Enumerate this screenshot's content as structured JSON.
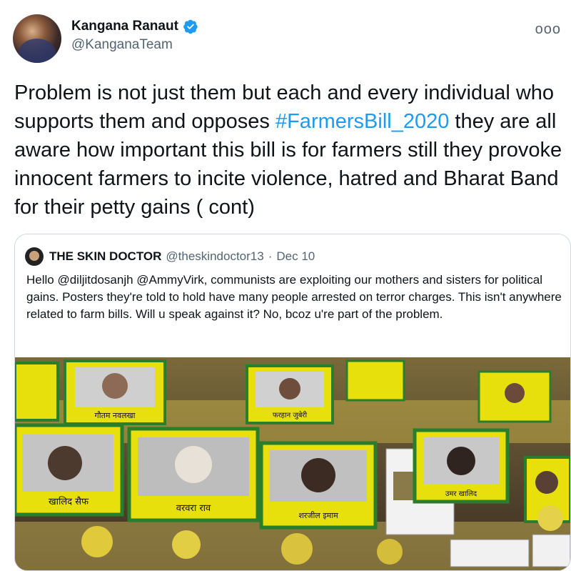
{
  "author": {
    "name": "Kangana Ranaut",
    "handle": "@KanganaTeam",
    "verified_icon": "verified-badge-icon"
  },
  "more_label": "ooo",
  "tweet": {
    "text_before": "Problem is not just them but each and every individual who supports them and opposes ",
    "hashtag": "#FarmersBill_2020",
    "text_after": " they are all aware how important this bill is for farmers still they provoke innocent farmers to incite violence, hatred and Bharat Band for their petty gains ( cont)"
  },
  "quoted": {
    "name": "THE SKIN DOCTOR",
    "handle": "@theskindoctor13",
    "separator": "·",
    "date": "Dec 10",
    "text": "Hello @diljitdosanjh @AmmyVirk, communists are exploiting our mothers and sisters for political gains. Posters they're told to hold have many people arrested on terror charges. This isn't anywhere related to farm bills. Will u speak against it? No, bcoz u're part of the problem."
  },
  "photo_posters": [
    "गौतम नवलखा",
    "फरहान जुबेरी",
    "खालिद सैफ",
    "वरवरा राव",
    "शरजील इमाम",
    "उमर खालिद"
  ],
  "colors": {
    "accent": "#1d9bf0",
    "poster_frame": "#e8e00c",
    "poster_border": "#2a7d2a"
  }
}
